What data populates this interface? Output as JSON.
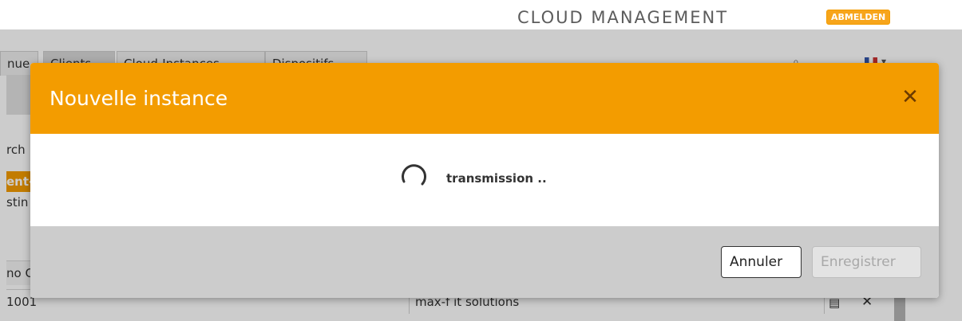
{
  "header": {
    "app_title": "CLOUD MANAGEMENT",
    "logout_label": "ABMELDEN"
  },
  "background": {
    "tabs": [
      "nue",
      "Clients",
      "Cloud-Instances",
      "Dispositifs"
    ],
    "search_label_fragment": "rch",
    "client_fragment": "ent-",
    "existing_fragment": "stin",
    "column_fragment": "no C",
    "row": {
      "id": "1001",
      "name": "max-f it solutions"
    }
  },
  "modal": {
    "title": "Nouvelle instance",
    "close_symbol": "✕",
    "loading_text": "transmission ..",
    "cancel_label": "Annuler",
    "save_label": "Enregistrer"
  },
  "colors": {
    "accent": "#f39c00",
    "footer": "#cccccc"
  }
}
